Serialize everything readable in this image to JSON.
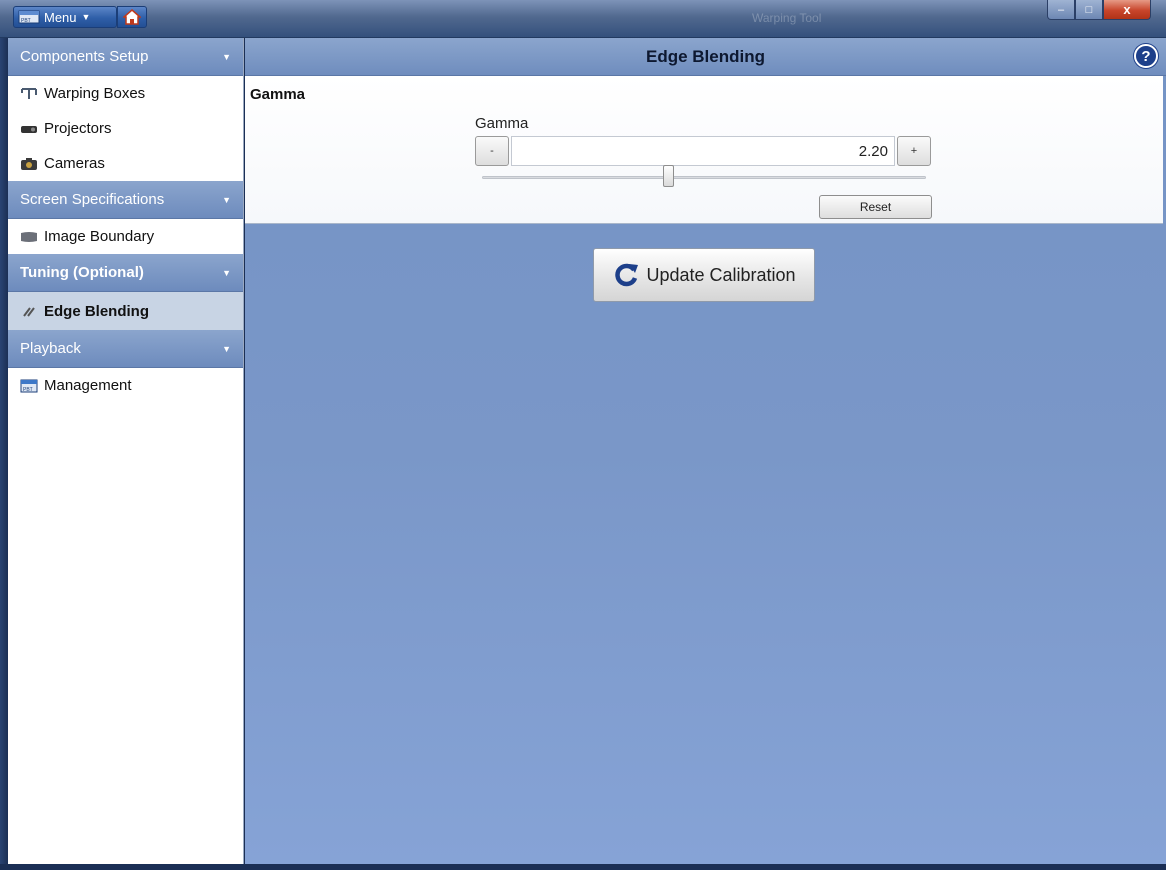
{
  "titlebar": {
    "menu_label": "Menu",
    "window_title": "Warping Tool",
    "minimize_label": "–",
    "maximize_label": "□",
    "close_label": "x"
  },
  "sidebar": {
    "sections": [
      {
        "header": "Components Setup",
        "items": [
          {
            "label": "Warping Boxes",
            "icon": "warping-box-icon"
          },
          {
            "label": "Projectors",
            "icon": "projector-icon"
          },
          {
            "label": "Cameras",
            "icon": "camera-icon"
          }
        ]
      },
      {
        "header": "Screen Specifications",
        "items": [
          {
            "label": "Image Boundary",
            "icon": "boundary-icon"
          }
        ]
      },
      {
        "header": "Tuning (Optional)",
        "items": [
          {
            "label": "Edge Blending",
            "icon": "wrench-icon"
          }
        ]
      },
      {
        "header": "Playback",
        "items": [
          {
            "label": "Management",
            "icon": "management-icon"
          }
        ]
      }
    ]
  },
  "main": {
    "title": "Edge Blending",
    "help_label": "?",
    "gamma_panel": {
      "title": "Gamma",
      "field_label": "Gamma",
      "value": "2.20",
      "minus_label": "-",
      "plus_label": "+",
      "slider_fraction": 0.42,
      "reset_label": "Reset"
    },
    "update_button_label": "Update Calibration"
  },
  "colors": {
    "accent": "#1d3f8a",
    "section_header": "#7b98c6",
    "main_bg": "#7a97c8"
  }
}
